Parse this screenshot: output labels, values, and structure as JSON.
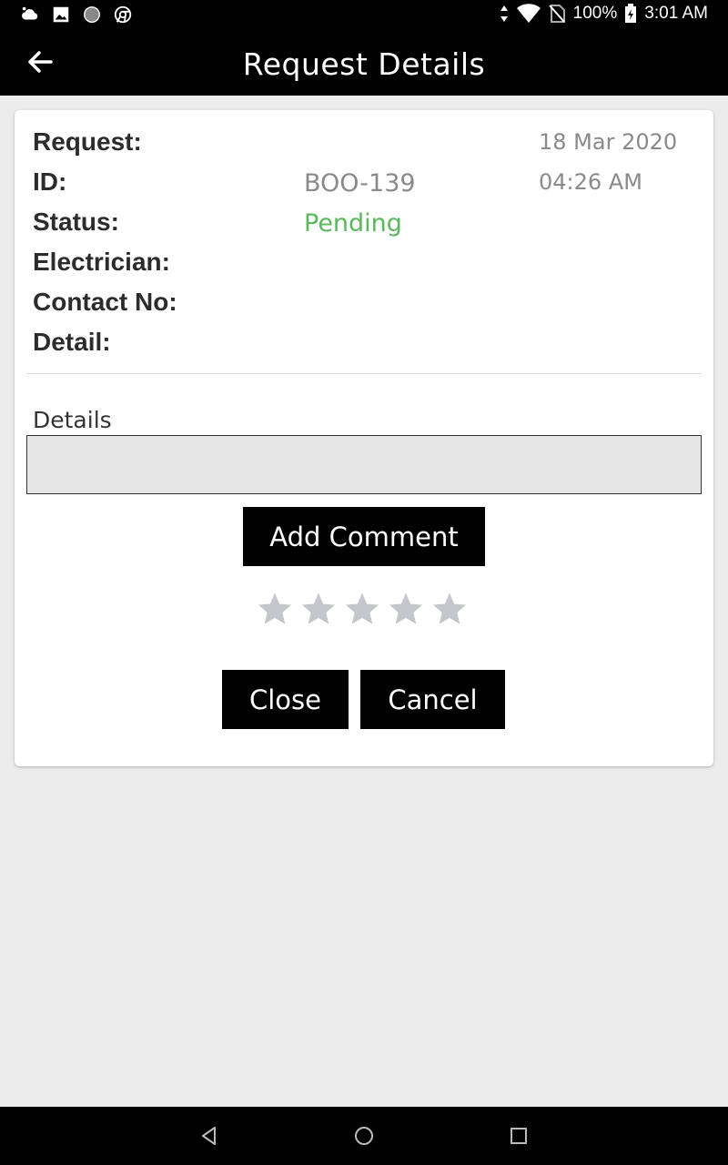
{
  "status_bar": {
    "battery": "100%",
    "time": "3:01 AM",
    "icons": [
      "cloud-icon",
      "image-icon",
      "circle-icon",
      "chrome-icon",
      "data-arrows-icon",
      "wifi-icon",
      "no-sim-icon",
      "battery-charging-icon"
    ]
  },
  "app_bar": {
    "title": "Request Details",
    "back_icon": "arrow-left-icon"
  },
  "request": {
    "labels": {
      "request": "Request:",
      "id": "ID:",
      "status": "Status:",
      "electrician": "Electrician:",
      "contact": "Contact No:",
      "detail": "Detail:"
    },
    "date": "18 Mar 2020",
    "time": "04:26 AM",
    "id_value": "BOO-139",
    "status_value": "Pending",
    "status_color": "#5cb85c"
  },
  "details": {
    "label": "Details",
    "value": ""
  },
  "buttons": {
    "add_comment": "Add Comment",
    "close": "Close",
    "cancel": "Cancel"
  },
  "rating": {
    "stars": 5,
    "value": 0,
    "star_color": "#c3c7cc"
  },
  "nav_bar": {
    "icons": [
      "back-triangle-icon",
      "home-circle-icon",
      "recents-square-icon"
    ]
  }
}
